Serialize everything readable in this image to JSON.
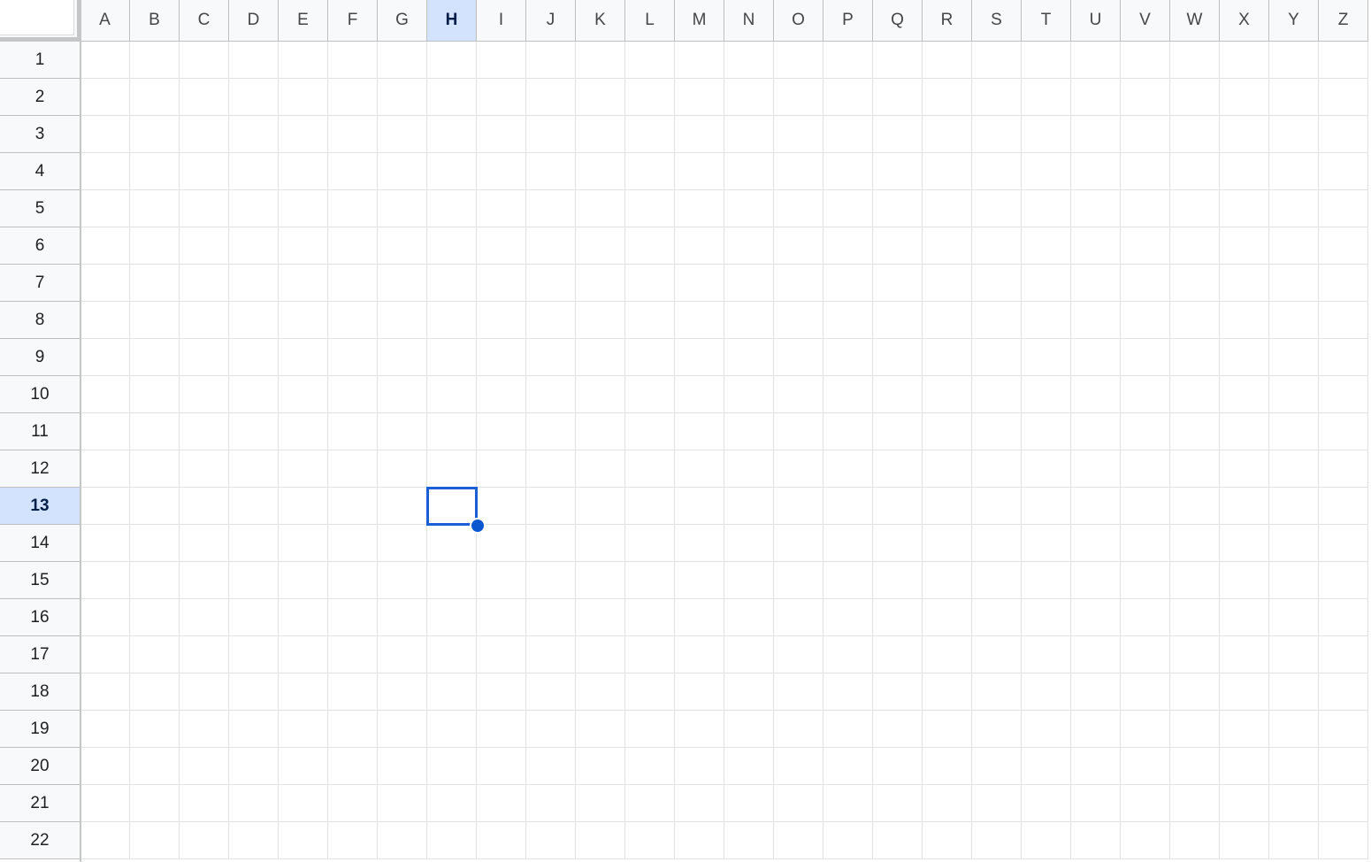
{
  "sheet": {
    "columns": [
      "A",
      "B",
      "C",
      "D",
      "E",
      "F",
      "G",
      "H",
      "I",
      "J",
      "K",
      "L",
      "M",
      "N",
      "O",
      "P",
      "Q",
      "R",
      "S",
      "T",
      "U",
      "V",
      "W",
      "X",
      "Y",
      "Z"
    ],
    "rows": [
      "1",
      "2",
      "3",
      "4",
      "5",
      "6",
      "7",
      "8",
      "9",
      "10",
      "11",
      "12",
      "13",
      "14",
      "15",
      "16",
      "17",
      "18",
      "19",
      "20",
      "21",
      "22"
    ],
    "active_column": "H",
    "active_row": "13",
    "active_cell": "H13",
    "active_cell_value": ""
  },
  "colors": {
    "selection_border": "#1a5fd6",
    "header_highlight": "#d3e3fd",
    "gridline": "#e2e2e2"
  }
}
